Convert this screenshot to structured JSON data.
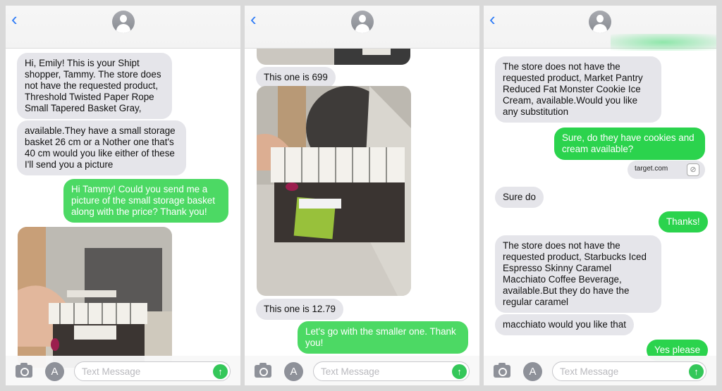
{
  "panels": [
    {
      "messages": [
        {
          "dir": "in",
          "text": "Hi, Emily! This is your Shipt shopper, Tammy. The store does not have the requested product, Threshold Twisted Paper Rope Small Tapered Basket Gray,"
        },
        {
          "dir": "in",
          "text": "available.They have a small storage basket 26 cm or a Nother one that's 40 cm would you like either of these I'll send you a picture"
        },
        {
          "dir": "out",
          "text": "Hi Tammy! Could you send me a picture of the small storage basket along with the price? Thank you!"
        },
        {
          "dir": "in",
          "type": "photo",
          "text": "Photo of small storage basket with striped liner on store shelf"
        }
      ]
    },
    {
      "messages": [
        {
          "dir": "in",
          "type": "photo",
          "text": "Photo (partially scrolled) of store floor"
        },
        {
          "dir": "in",
          "text": "This one is 699"
        },
        {
          "dir": "in",
          "type": "photo",
          "text": "Photo of dark woven basket with striped liner and green tag"
        },
        {
          "dir": "in",
          "text": "This one is 12.79"
        },
        {
          "dir": "out",
          "text": "Let's go with the smaller one. Thank you!"
        }
      ]
    },
    {
      "messages": [
        {
          "dir": "in",
          "text": "The store does not have the requested product, Market Pantry Reduced Fat Monster Cookie Ice Cream, available.Would you like any substitution"
        },
        {
          "dir": "out",
          "text": "Sure, do they have cookies and cream available?"
        },
        {
          "dir": "link",
          "text": "target.com"
        },
        {
          "dir": "in",
          "text": "Sure do"
        },
        {
          "dir": "out",
          "text": "Thanks!"
        },
        {
          "dir": "in",
          "text": "The store does not have the requested product, Starbucks Iced Espresso Skinny Caramel Macchiato Coffee Beverage, available.But they do have the regular caramel"
        },
        {
          "dir": "in",
          "text": "macchiato would you like that"
        },
        {
          "dir": "out",
          "text": "Yes please"
        }
      ]
    }
  ],
  "composer": {
    "placeholder": "Text Message",
    "back_icon": "‹",
    "appstore_icon": "A",
    "send_icon": "↑"
  },
  "colors": {
    "incoming": "#e5e5ea",
    "outgoing": "#4cd964",
    "link": "#2f7cf6"
  }
}
